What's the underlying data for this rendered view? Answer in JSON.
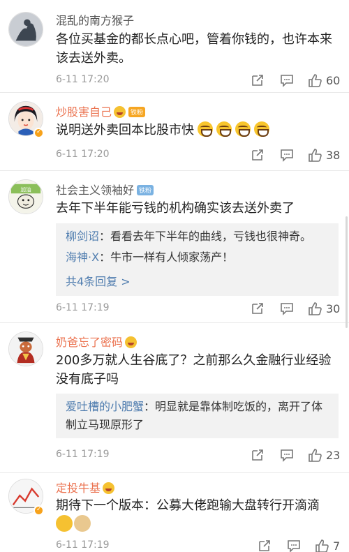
{
  "comments": [
    {
      "user": "混乱的南方猴子",
      "text": "各位买基金的都长点心吧，管着你钱的，也许本来该去送外卖。",
      "time": "6-11 17:20",
      "likes": "60"
    },
    {
      "user": "炒股害自己",
      "fan_badge": "铁粉",
      "text": "说明送外卖回本比股市快",
      "time": "6-11 17:20",
      "likes": "38"
    },
    {
      "user": "社会主义领袖好",
      "fan_badge": "铁粉",
      "text": "去年下半年能亏钱的机构确实该去送外卖了",
      "replies": [
        {
          "name": "柳剑诏",
          "text": "：看看去年下半年的曲线，亏钱也很神奇。"
        },
        {
          "name": "海神·X",
          "text": "：牛市一样有人倾家荡产！"
        }
      ],
      "more": "共4条回复 >",
      "time": "6-11 17:19",
      "likes": "30"
    },
    {
      "user": "奶爸忘了密码",
      "text": "200多万就人生谷底了？之前那么久金融行业经验没有底子吗",
      "replies": [
        {
          "name": "爱吐槽的小肥蟹",
          "text": "：明显就是靠体制吃饭的，离开了体制立马现原形了"
        }
      ],
      "time": "6-11 17:19",
      "likes": "23"
    },
    {
      "user": "定投牛基",
      "text": "期待下一个版本：公募大佬跑输大盘转行开滴滴",
      "time": "6-11 17:19",
      "likes": "7"
    }
  ],
  "colors": {
    "name_gray": "#555555",
    "name_orange": "#eb7350",
    "link_blue": "#507daf",
    "meta_gray": "#999999"
  },
  "icons": [
    "share-icon",
    "reply-icon",
    "like-icon",
    "verified-badge-icon",
    "laugh-emoji-icon"
  ]
}
